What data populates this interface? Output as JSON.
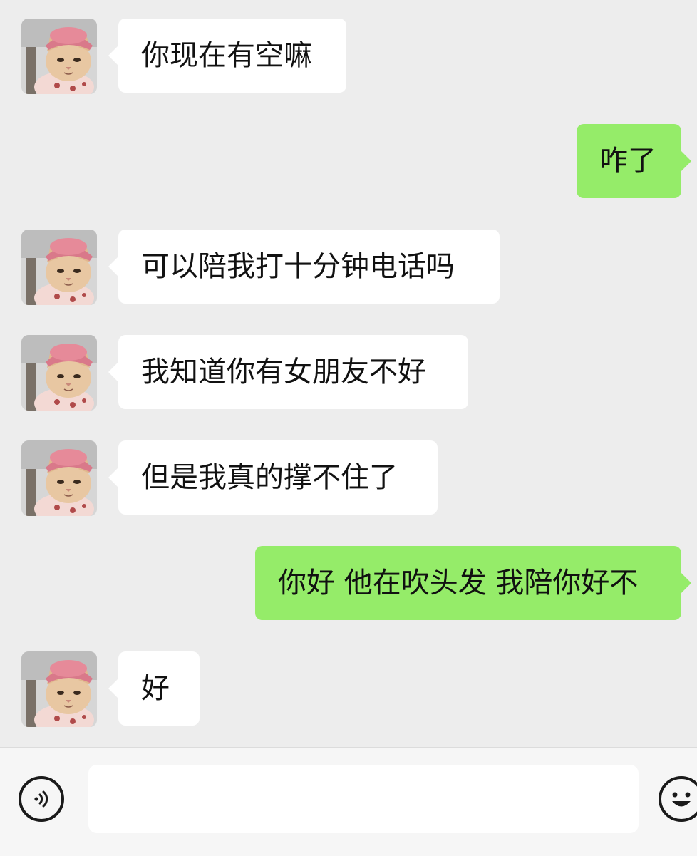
{
  "contact": {
    "avatar_icon": "cat-with-pink-hat-avatar"
  },
  "messages": [
    {
      "side": "in",
      "text": "你现在有空嘛"
    },
    {
      "side": "out",
      "text": "咋了"
    },
    {
      "side": "in",
      "text": "可以陪我打十分钟电话吗"
    },
    {
      "side": "in",
      "text": "我知道你有女朋友不好"
    },
    {
      "side": "in",
      "text": "但是我真的撑不住了"
    },
    {
      "side": "out",
      "text": "你好 他在吹头发 我陪你好不"
    },
    {
      "side": "in",
      "text": "好"
    }
  ],
  "input_bar": {
    "placeholder": "",
    "voice_icon": "voice-icon",
    "emoji_icon": "emoji-icon"
  },
  "colors": {
    "background": "#ededed",
    "incoming_bubble": "#ffffff",
    "outgoing_bubble": "#95ec69"
  }
}
